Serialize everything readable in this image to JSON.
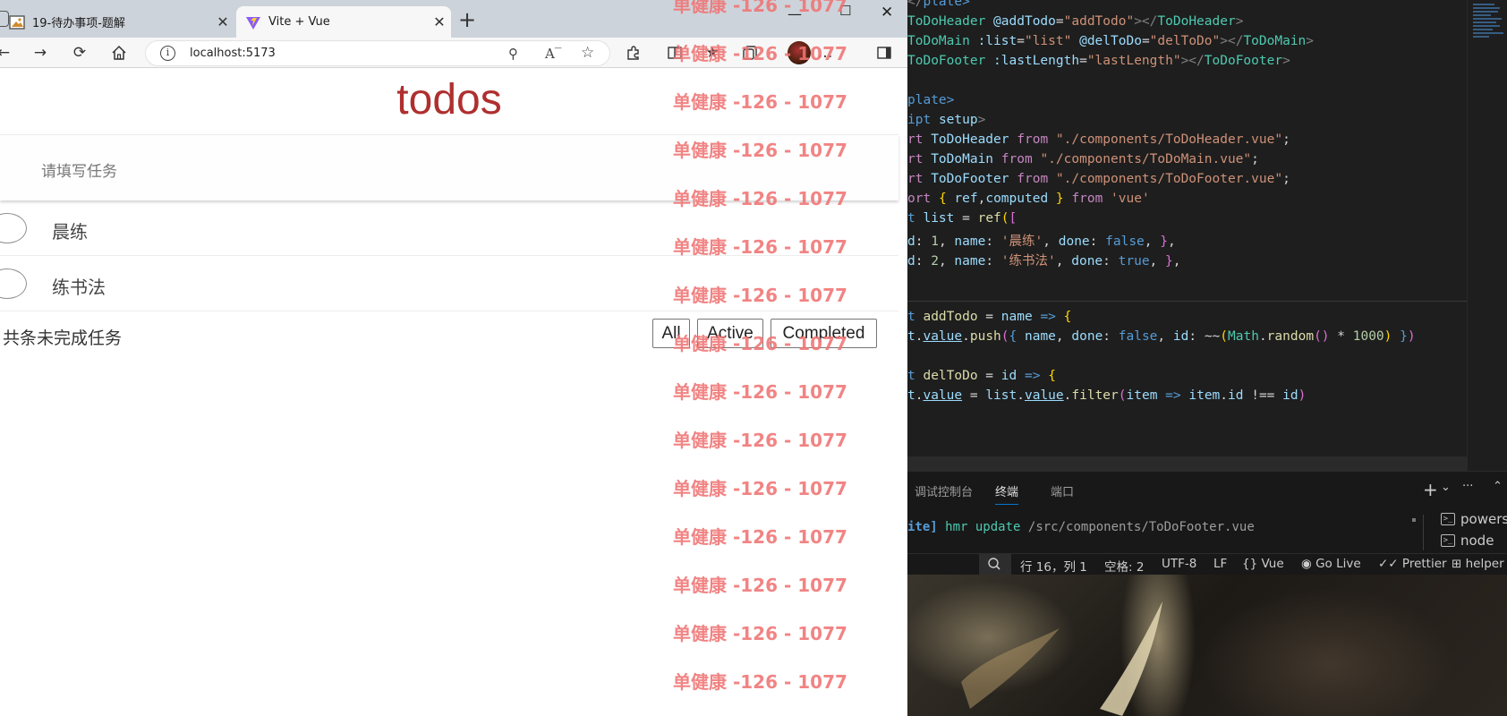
{
  "browser": {
    "tabs": [
      {
        "title": "19-待办事项-题解",
        "close": "✕"
      },
      {
        "title": "Vite + Vue",
        "close": "✕"
      }
    ],
    "new_tab": "+",
    "window_controls": {
      "minimize": "—",
      "maximize": "☐",
      "close": "✕"
    },
    "url": "localhost:5173",
    "icons": [
      "back-icon",
      "forward-icon",
      "reload-icon",
      "home-icon",
      "info-icon",
      "zoom-icon",
      "read-aloud-icon",
      "favorite-icon",
      "extensions-icon",
      "split-screen-icon",
      "favorites-bar-icon",
      "collections-icon",
      "profile-icon",
      "more-icon",
      "sidebar-icon"
    ],
    "more_label": "…"
  },
  "app": {
    "title": "todos",
    "placeholder": "请填写任务",
    "todos": [
      {
        "name": "晨练",
        "done": false
      },
      {
        "name": "练书法",
        "done": true
      }
    ],
    "footer_text": "共条未完成任务",
    "filters": [
      "All",
      "Active",
      "Completed"
    ]
  },
  "watermark": {
    "text": "单健康 -126 - 1077",
    "color": "#f07474"
  },
  "editor": {
    "code_lines": [
      "plate>",
      "ToDoHeader @addTodo=\"addTodo\"></ToDoHeader>",
      "ToDoMain :list=\"list\" @delToDo=\"delToDo\"></ToDoMain>",
      "ToDoFooter :lastLength=\"lastLength\"></ToDoFooter>",
      "",
      "plate>",
      "ipt setup>",
      "rt ToDoHeader from \"./components/ToDoHeader.vue\";",
      "rt ToDoMain from \"./components/ToDoMain.vue\";",
      "rt ToDoFooter from \"./components/ToDoFooter.vue\";",
      "ort { ref,computed } from 'vue'",
      "t list = ref([",
      "d: 1, name: '晨练', done: false, },",
      "d: 2, name: '练书法', done: true, },",
      "",
      "",
      "t addTodo = name => {",
      "t.value.push({ name, done: false, id: ~~(Math.random() * 1000) })",
      "",
      "t delToDo = id => {",
      "t.value = list.value.filter(item => item.id !== id)"
    ]
  },
  "panel": {
    "tabs": [
      "调试控制台",
      "终端",
      "端口"
    ],
    "active_tab": "终端",
    "terminal_line": "ite] hmr update /src/components/ToDoFooter.vue",
    "terminals": [
      "powersh",
      "node"
    ],
    "actions": [
      "+",
      "⌄",
      "···",
      "⌃"
    ]
  },
  "statusbar": {
    "items": [
      "行 16，列 1",
      "空格: 2",
      "UTF-8",
      "LF",
      "{} Vue",
      "Go Live",
      "Prettier",
      "helper"
    ]
  },
  "colors": {
    "todo_title": "#af2f2f",
    "editor_bg": "#1e1e1e",
    "keyword": "#569cd6",
    "string": "#ce9178",
    "tag": "#4ec9b0"
  }
}
